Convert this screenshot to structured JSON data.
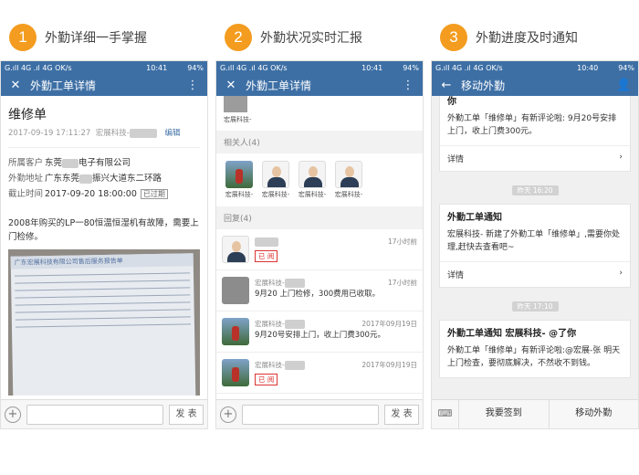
{
  "steps": [
    {
      "num": "1",
      "label": "外勤详细一手掌握"
    },
    {
      "num": "2",
      "label": "外勤状况实时汇报"
    },
    {
      "num": "3",
      "label": "外勤进度及时通知"
    }
  ],
  "status": {
    "left": "G.ıll 4G .ıl 4G OK/s",
    "time1": "10:41",
    "time2": "10:41",
    "time3": "10:40",
    "right": "94%"
  },
  "phone1": {
    "bar_title": "外勤工单详情",
    "order_title": "维修单",
    "meta_date": "2017-09-19 17:11:27",
    "meta_company": "宏展科技-",
    "edit_label": "编辑",
    "rows": [
      {
        "k": "所属客户",
        "v1": "东莞",
        "v2": "电子有限公司"
      },
      {
        "k": "外勤地址",
        "v1": "广东东莞",
        "v2": "振兴大道东二环路"
      },
      {
        "k": "截止时间",
        "v1": "2017-09-20 18:00:00",
        "v2": "已过期"
      }
    ],
    "description": "2008年购买的LP一80恒温恒湿机有故障，需要上门检修。",
    "doc_header": "广东宏展科技有限公司售后服务报告单",
    "send_label": "发 表"
  },
  "phone2": {
    "bar_title": "外勤工单详情",
    "top_label": "宏展科技-",
    "related_header": "相关人(4)",
    "related_names": [
      "宏展科技-",
      "宏展科技-",
      "宏展科技-",
      "宏展科技-"
    ],
    "reply_header": "回复(4)",
    "replies": [
      {
        "name": "",
        "time": "17小时前",
        "text": "",
        "stamp": "已 阅"
      },
      {
        "name": "宏展科技-",
        "time": "17小时前",
        "text": "9月20    上门检修，300费用已收取。",
        "stamp": ""
      },
      {
        "name": "宏展科技-",
        "time": "2017年09月19日",
        "text": "9月20号安排上门，收上门费300元。",
        "stamp": ""
      },
      {
        "name": "宏展科技-",
        "time": "2017年09月19日",
        "text": "",
        "stamp": "已 阅"
      }
    ],
    "send_label": "发 表"
  },
  "phone3": {
    "bar_title": "移动外勤",
    "card0": {
      "title": "你",
      "body": "外勤工单「维修单」有新评论啦:        9月20号安排上门，收上门费300元。",
      "more": "详情"
    },
    "time1": "昨天 16:20",
    "card1": {
      "title": "外勤工单通知",
      "body": "宏展科技-         新建了外勤工单「维修单」,需要你处理,赶快去查看吧~",
      "more": "详情"
    },
    "time2": "昨天 17:10",
    "card2": {
      "title": "外勤工单通知 宏展科技-           @了你",
      "body": "外勤工单「维修单」有新评论啦:@宏展-张    明天上门检查，要彻底解决，不然收不到钱。"
    },
    "bottom": [
      "我要签到",
      "移动外勤"
    ]
  }
}
